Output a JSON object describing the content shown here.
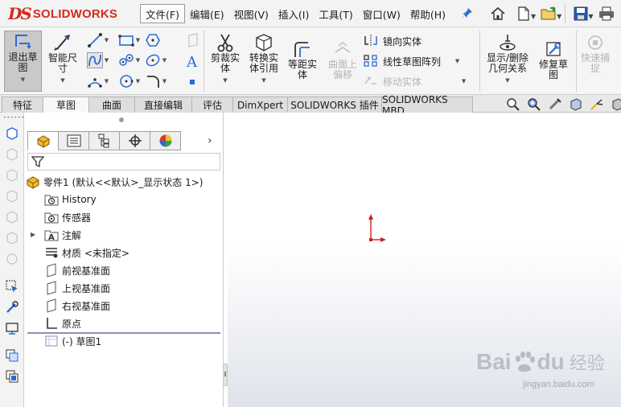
{
  "app": {
    "logo_mark": "DS",
    "logo_text": "SOLIDWORKS"
  },
  "menubar": {
    "items": [
      {
        "label": "文件(F)"
      },
      {
        "label": "编辑(E)"
      },
      {
        "label": "视图(V)"
      },
      {
        "label": "插入(I)"
      },
      {
        "label": "工具(T)"
      },
      {
        "label": "窗口(W)"
      },
      {
        "label": "帮助(H)"
      }
    ],
    "pin_icon": "pin-icon",
    "quick_icons": [
      "home-icon",
      "new-document-icon",
      "open-folder-icon",
      "save-icon",
      "print-icon"
    ]
  },
  "ribbon": {
    "exit_sketch": "退出草图",
    "smart_dimension": "智能尺寸",
    "trim_entities": "剪裁实体",
    "convert_entities": "转换实体引用",
    "offset_entities": "等距实体",
    "offset_on_surface": "曲面上偏移",
    "mirror_entities": "镜向实体",
    "linear_pattern": "线性草图阵列",
    "move_entities": "移动实体",
    "display_relations": "显示/删除几何关系",
    "repair_sketch": "修复草图",
    "rapid_snaps": "快速捕捉"
  },
  "command_tabs": [
    {
      "label": "特征",
      "active": false
    },
    {
      "label": "草图",
      "active": true
    },
    {
      "label": "曲面",
      "active": false
    },
    {
      "label": "直接编辑",
      "active": false
    },
    {
      "label": "评估",
      "active": false
    },
    {
      "label": "DimXpert",
      "active": false
    },
    {
      "label": "SOLIDWORKS 插件",
      "active": false
    },
    {
      "label": "SOLIDWORKS MBD",
      "active": false
    }
  ],
  "feature_tree": {
    "root": "零件1  (默认<<默认>_显示状态 1>)",
    "items": [
      {
        "label": "History",
        "icon": "history-folder-icon"
      },
      {
        "label": "传感器",
        "icon": "sensor-icon"
      },
      {
        "label": "注解",
        "icon": "annotations-icon",
        "expandable": true
      },
      {
        "label": "材质 <未指定>",
        "icon": "material-icon"
      },
      {
        "label": "前视基准面",
        "icon": "plane-icon"
      },
      {
        "label": "上视基准面",
        "icon": "plane-icon"
      },
      {
        "label": "右视基准面",
        "icon": "plane-icon"
      },
      {
        "label": "原点",
        "icon": "origin-icon"
      },
      {
        "label": "(-) 草图1",
        "icon": "sketch-icon"
      }
    ]
  },
  "watermark": {
    "brand_left": "Bai",
    "brand_right": "du",
    "brand_cn": "经验",
    "url": "jingyan.baidu.com"
  },
  "colors": {
    "brand_red": "#d42b1e",
    "origin_red": "#cc1f1f",
    "active_tab_bg": "#f8f8f8",
    "rollback_bar": "#8f8fc4"
  }
}
